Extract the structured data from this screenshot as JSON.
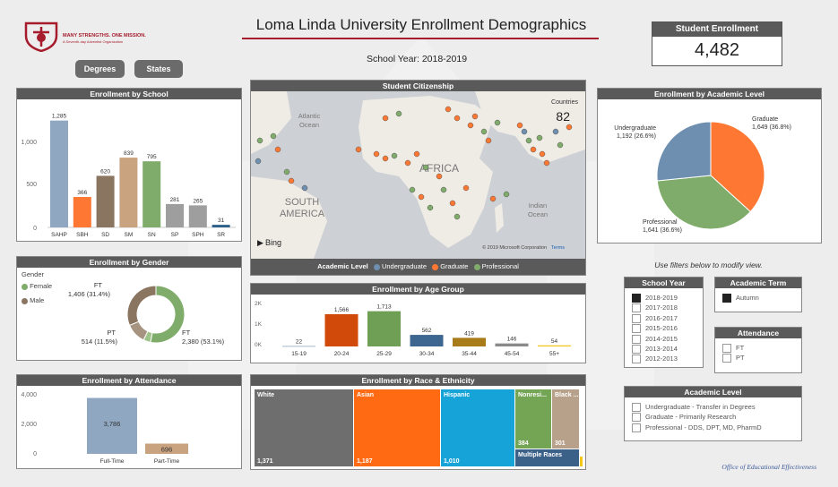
{
  "header": {
    "title": "Loma Linda University Enrollment Demographics",
    "school_year_label": "School Year: 2018-2019",
    "logo_line1": "MANY STRENGTHS. ONE MISSION.",
    "logo_line2": "A Seventh-day Adventist Organization",
    "footer": "Office of Educational Effectiveness"
  },
  "nav": {
    "degrees": "Degrees",
    "states": "States"
  },
  "kpi": {
    "title": "Student Enrollment",
    "value": "4,482"
  },
  "school": {
    "title": "Enrollment by School",
    "ticks": [
      "1,000",
      "500",
      "0"
    ],
    "chart_data": {
      "type": "bar",
      "categories": [
        "SAHP",
        "SBH",
        "SD",
        "SM",
        "SN",
        "SP",
        "SPH",
        "SR"
      ],
      "values": [
        1285,
        366,
        620,
        839,
        795,
        281,
        265,
        31
      ],
      "labels": [
        "1,285",
        "366",
        "620",
        "839",
        "795",
        "281",
        "265",
        "31"
      ],
      "colors": [
        "#8fa7c1",
        "#ff7833",
        "#8a7561",
        "#c9a27f",
        "#7fac6a",
        "#9e9e9e",
        "#9e9e9e",
        "#2e5f8a"
      ],
      "ylim": [
        0,
        1400
      ]
    }
  },
  "gender": {
    "title": "Enrollment by Gender",
    "legend_title": "Gender",
    "legend": [
      {
        "label": "Female",
        "color": "#7fac6a"
      },
      {
        "label": "Male",
        "color": "#8a7561"
      }
    ],
    "labels": {
      "male_ft": "FT",
      "male_ft_val": "1,406 (31.4%)",
      "male_pt": "PT",
      "male_pt_val": "514 (11.5%)",
      "fem_ft": "FT",
      "fem_ft_val": "2,380 (53.1%)"
    },
    "chart_data": {
      "type": "pie",
      "slices": [
        {
          "name": "Female FT",
          "value": 2380,
          "color": "#7fac6a"
        },
        {
          "name": "Female PT",
          "value": 182,
          "color": "#9fc48a"
        },
        {
          "name": "Male PT",
          "value": 514,
          "color": "#a69380"
        },
        {
          "name": "Male FT",
          "value": 1406,
          "color": "#8a7561"
        }
      ]
    }
  },
  "attendance": {
    "title": "Enrollment by Attendance",
    "ticks": [
      "4,000",
      "2,000",
      "0"
    ],
    "chart_data": {
      "type": "bar",
      "categories": [
        "Full-Time",
        "Part-Time"
      ],
      "values": [
        3786,
        696
      ],
      "labels": [
        "3,786",
        "696"
      ],
      "colors": [
        "#8fa7c1",
        "#c9a27f"
      ],
      "ylim": [
        0,
        4000
      ]
    }
  },
  "citizenship": {
    "title": "Student Citizenship",
    "countries_label": "Countries",
    "countries_value": "82",
    "map_labels": {
      "atlantic": "Atlantic",
      "ocean": "Ocean",
      "africa": "AFRICA",
      "south": "SOUTH",
      "america": "AMERICA",
      "indian": "Indian",
      "indian_ocean": "Ocean"
    },
    "bing": "Bing",
    "copyright": "© 2019 Microsoft Corporation",
    "terms": "Terms",
    "legend_title": "Academic Level",
    "legend": [
      {
        "label": "Undergraduate",
        "color": "#6f8fb0"
      },
      {
        "label": "Graduate",
        "color": "#ff7833"
      },
      {
        "label": "Professional",
        "color": "#7fac6a"
      }
    ]
  },
  "age": {
    "title": "Enrollment by Age Group",
    "ticks": [
      "2K",
      "1K",
      "0K"
    ],
    "chart_data": {
      "type": "bar",
      "categories": [
        "15-19",
        "20-24",
        "25-29",
        "30-34",
        "35-44",
        "45-54",
        "55+"
      ],
      "values": [
        22,
        1566,
        1713,
        562,
        419,
        146,
        54
      ],
      "labels": [
        "22",
        "1,566",
        "1,713",
        "562",
        "419",
        "146",
        "54"
      ],
      "colors": [
        "#8fa7c1",
        "#d24a0a",
        "#6f9e55",
        "#3d6690",
        "#a87c1a",
        "#8a8a8a",
        "#f5c518"
      ],
      "ylim": [
        0,
        2000
      ]
    }
  },
  "race": {
    "title": "Enrollment by Race & Ethnicity",
    "chart_data": {
      "type": "table",
      "cells": [
        {
          "name": "White",
          "value": "1,371",
          "color": "#6e6e6e"
        },
        {
          "name": "Asian",
          "value": "1,187",
          "color": "#ff6a13"
        },
        {
          "name": "Hispanic",
          "value": "1,010",
          "color": "#16a3d8"
        },
        {
          "name": "Nonresi...",
          "value": "384",
          "color": "#73a554"
        },
        {
          "name": "Black ...",
          "value": "301",
          "color": "#b8a18a"
        },
        {
          "name": "Multiple Races",
          "value": "",
          "color": "#3c6189"
        }
      ]
    }
  },
  "academic": {
    "title": "Enrollment by Academic Level",
    "labels": {
      "ug": "Undergraduate",
      "ug_val": "1,192 (26.6%)",
      "gr": "Graduate",
      "gr_val": "1,649 (36.8%)",
      "pr": "Professional",
      "pr_val": "1,641 (36.6%)"
    },
    "chart_data": {
      "type": "pie",
      "slices": [
        {
          "name": "Graduate",
          "value": 1649,
          "color": "#ff7833"
        },
        {
          "name": "Professional",
          "value": 1641,
          "color": "#7fac6a"
        },
        {
          "name": "Undergraduate",
          "value": 1192,
          "color": "#6f8fb0"
        }
      ]
    }
  },
  "filters": {
    "hint": "Use filters below to modify view.",
    "school_year": {
      "title": "School Year",
      "options": [
        {
          "label": "2018-2019",
          "checked": true
        },
        {
          "label": "2017-2018",
          "checked": false
        },
        {
          "label": "2016-2017",
          "checked": false
        },
        {
          "label": "2015-2016",
          "checked": false
        },
        {
          "label": "2014-2015",
          "checked": false
        },
        {
          "label": "2013-2014",
          "checked": false
        },
        {
          "label": "2012-2013",
          "checked": false
        }
      ]
    },
    "term": {
      "title": "Academic Term",
      "options": [
        {
          "label": "Autumn",
          "checked": true
        }
      ]
    },
    "attendance": {
      "title": "Attendance",
      "options": [
        {
          "label": "FT",
          "checked": false
        },
        {
          "label": "PT",
          "checked": false
        }
      ]
    },
    "level": {
      "title": "Academic Level",
      "options": [
        {
          "label": "Undergraduate - Transfer in Degrees",
          "checked": false
        },
        {
          "label": "Graduate - Primarily Research",
          "checked": false
        },
        {
          "label": "Professional - DDS, DPT, MD, PharmD",
          "checked": false
        }
      ]
    }
  }
}
